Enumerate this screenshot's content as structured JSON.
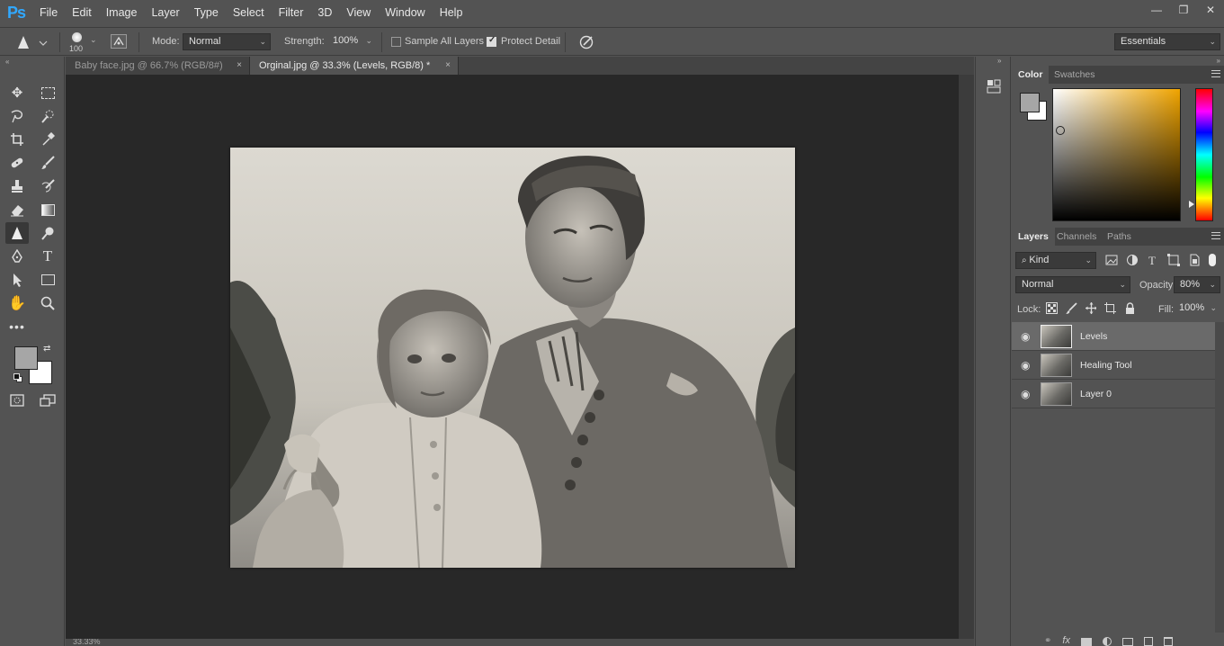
{
  "app": {
    "logo": "Ps"
  },
  "menu": [
    "File",
    "Edit",
    "Image",
    "Layer",
    "Type",
    "Select",
    "Filter",
    "3D",
    "View",
    "Window",
    "Help"
  ],
  "window_controls": {
    "minimize": "—",
    "restore": "❐",
    "close": "✕"
  },
  "options": {
    "brush_size": "100",
    "mode_label": "Mode:",
    "mode_value": "Normal",
    "strength_label": "Strength:",
    "strength_value": "100%",
    "sample_all_layers": "Sample All Layers",
    "sample_all_layers_checked": false,
    "protect_detail": "Protect Detail",
    "protect_detail_checked": true,
    "workspace": "Essentials"
  },
  "tabs": [
    {
      "label": "Baby face.jpg @ 66.7% (RGB/8#)",
      "active": false
    },
    {
      "label": "Orginal.jpg @ 33.3% (Levels, RGB/8) *",
      "active": true
    }
  ],
  "tab_close_glyph": "×",
  "status": {
    "zoom": "33.33%"
  },
  "color_panel": {
    "tabs": [
      "Color",
      "Swatches"
    ],
    "foreground": "#a6a6a6",
    "background": "#ffffff",
    "hue_color": "#f0a400"
  },
  "layers_panel": {
    "tabs": [
      "Layers",
      "Channels",
      "Paths"
    ],
    "kind_label": "Kind",
    "blend_mode": "Normal",
    "opacity_label": "Opacity:",
    "opacity_value": "80%",
    "lock_label": "Lock:",
    "fill_label": "Fill:",
    "fill_value": "100%",
    "layers": [
      {
        "name": "Levels",
        "selected": true
      },
      {
        "name": "Healing Tool",
        "selected": false
      },
      {
        "name": "Layer 0",
        "selected": false
      }
    ]
  },
  "tools_panel": {
    "foreground": "#a6a6a6",
    "background": "#ffffff"
  }
}
